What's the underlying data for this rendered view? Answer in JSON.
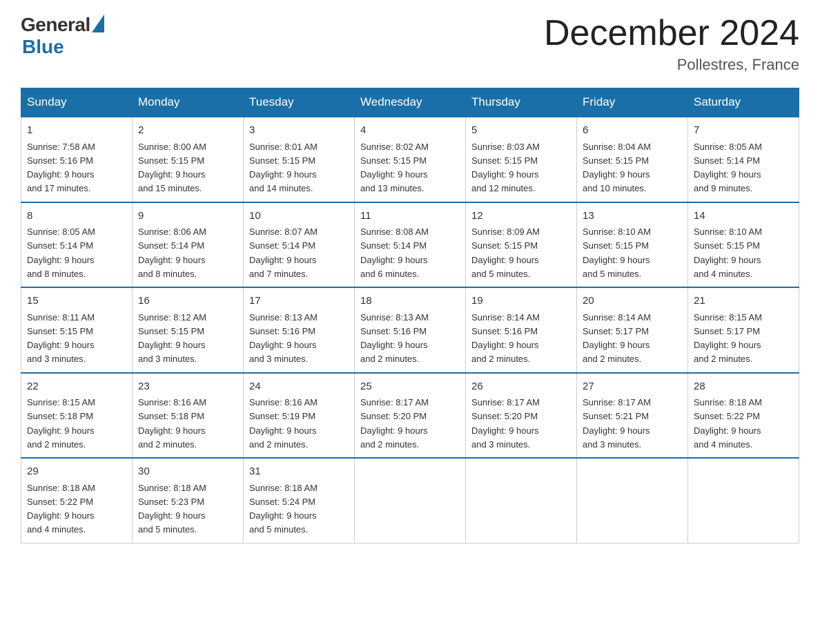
{
  "logo": {
    "general": "General",
    "blue": "Blue"
  },
  "title": "December 2024",
  "location": "Pollestres, France",
  "days_of_week": [
    "Sunday",
    "Monday",
    "Tuesday",
    "Wednesday",
    "Thursday",
    "Friday",
    "Saturday"
  ],
  "weeks": [
    [
      {
        "day": "1",
        "sunrise": "7:58 AM",
        "sunset": "5:16 PM",
        "daylight": "9 hours and 17 minutes."
      },
      {
        "day": "2",
        "sunrise": "8:00 AM",
        "sunset": "5:15 PM",
        "daylight": "9 hours and 15 minutes."
      },
      {
        "day": "3",
        "sunrise": "8:01 AM",
        "sunset": "5:15 PM",
        "daylight": "9 hours and 14 minutes."
      },
      {
        "day": "4",
        "sunrise": "8:02 AM",
        "sunset": "5:15 PM",
        "daylight": "9 hours and 13 minutes."
      },
      {
        "day": "5",
        "sunrise": "8:03 AM",
        "sunset": "5:15 PM",
        "daylight": "9 hours and 12 minutes."
      },
      {
        "day": "6",
        "sunrise": "8:04 AM",
        "sunset": "5:15 PM",
        "daylight": "9 hours and 10 minutes."
      },
      {
        "day": "7",
        "sunrise": "8:05 AM",
        "sunset": "5:14 PM",
        "daylight": "9 hours and 9 minutes."
      }
    ],
    [
      {
        "day": "8",
        "sunrise": "8:05 AM",
        "sunset": "5:14 PM",
        "daylight": "9 hours and 8 minutes."
      },
      {
        "day": "9",
        "sunrise": "8:06 AM",
        "sunset": "5:14 PM",
        "daylight": "9 hours and 8 minutes."
      },
      {
        "day": "10",
        "sunrise": "8:07 AM",
        "sunset": "5:14 PM",
        "daylight": "9 hours and 7 minutes."
      },
      {
        "day": "11",
        "sunrise": "8:08 AM",
        "sunset": "5:14 PM",
        "daylight": "9 hours and 6 minutes."
      },
      {
        "day": "12",
        "sunrise": "8:09 AM",
        "sunset": "5:15 PM",
        "daylight": "9 hours and 5 minutes."
      },
      {
        "day": "13",
        "sunrise": "8:10 AM",
        "sunset": "5:15 PM",
        "daylight": "9 hours and 5 minutes."
      },
      {
        "day": "14",
        "sunrise": "8:10 AM",
        "sunset": "5:15 PM",
        "daylight": "9 hours and 4 minutes."
      }
    ],
    [
      {
        "day": "15",
        "sunrise": "8:11 AM",
        "sunset": "5:15 PM",
        "daylight": "9 hours and 3 minutes."
      },
      {
        "day": "16",
        "sunrise": "8:12 AM",
        "sunset": "5:15 PM",
        "daylight": "9 hours and 3 minutes."
      },
      {
        "day": "17",
        "sunrise": "8:13 AM",
        "sunset": "5:16 PM",
        "daylight": "9 hours and 3 minutes."
      },
      {
        "day": "18",
        "sunrise": "8:13 AM",
        "sunset": "5:16 PM",
        "daylight": "9 hours and 2 minutes."
      },
      {
        "day": "19",
        "sunrise": "8:14 AM",
        "sunset": "5:16 PM",
        "daylight": "9 hours and 2 minutes."
      },
      {
        "day": "20",
        "sunrise": "8:14 AM",
        "sunset": "5:17 PM",
        "daylight": "9 hours and 2 minutes."
      },
      {
        "day": "21",
        "sunrise": "8:15 AM",
        "sunset": "5:17 PM",
        "daylight": "9 hours and 2 minutes."
      }
    ],
    [
      {
        "day": "22",
        "sunrise": "8:15 AM",
        "sunset": "5:18 PM",
        "daylight": "9 hours and 2 minutes."
      },
      {
        "day": "23",
        "sunrise": "8:16 AM",
        "sunset": "5:18 PM",
        "daylight": "9 hours and 2 minutes."
      },
      {
        "day": "24",
        "sunrise": "8:16 AM",
        "sunset": "5:19 PM",
        "daylight": "9 hours and 2 minutes."
      },
      {
        "day": "25",
        "sunrise": "8:17 AM",
        "sunset": "5:20 PM",
        "daylight": "9 hours and 2 minutes."
      },
      {
        "day": "26",
        "sunrise": "8:17 AM",
        "sunset": "5:20 PM",
        "daylight": "9 hours and 3 minutes."
      },
      {
        "day": "27",
        "sunrise": "8:17 AM",
        "sunset": "5:21 PM",
        "daylight": "9 hours and 3 minutes."
      },
      {
        "day": "28",
        "sunrise": "8:18 AM",
        "sunset": "5:22 PM",
        "daylight": "9 hours and 4 minutes."
      }
    ],
    [
      {
        "day": "29",
        "sunrise": "8:18 AM",
        "sunset": "5:22 PM",
        "daylight": "9 hours and 4 minutes."
      },
      {
        "day": "30",
        "sunrise": "8:18 AM",
        "sunset": "5:23 PM",
        "daylight": "9 hours and 5 minutes."
      },
      {
        "day": "31",
        "sunrise": "8:18 AM",
        "sunset": "5:24 PM",
        "daylight": "9 hours and 5 minutes."
      },
      null,
      null,
      null,
      null
    ]
  ],
  "labels": {
    "sunrise": "Sunrise:",
    "sunset": "Sunset:",
    "daylight": "Daylight:"
  }
}
